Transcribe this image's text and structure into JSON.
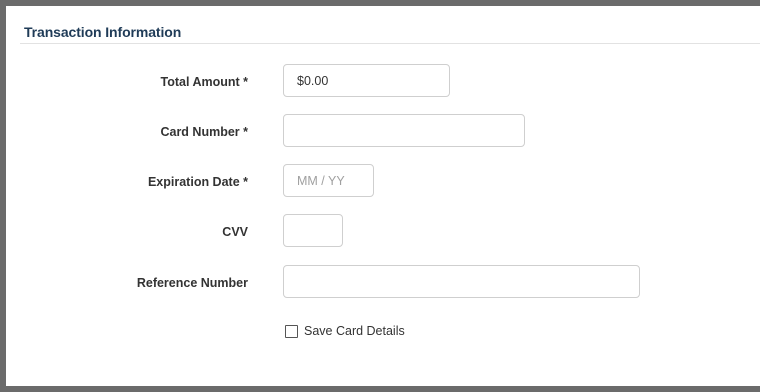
{
  "section": {
    "title": "Transaction Information"
  },
  "form": {
    "total_amount": {
      "label": "Total Amount *",
      "value": "$0.00"
    },
    "card_number": {
      "label": "Card Number *",
      "value": ""
    },
    "expiration_date": {
      "label": "Expiration Date *",
      "placeholder": "MM / YY"
    },
    "cvv": {
      "label": "CVV",
      "value": ""
    },
    "reference_number": {
      "label": "Reference Number",
      "value": ""
    },
    "save_card": {
      "label": "Save Card Details",
      "checked": false
    }
  }
}
